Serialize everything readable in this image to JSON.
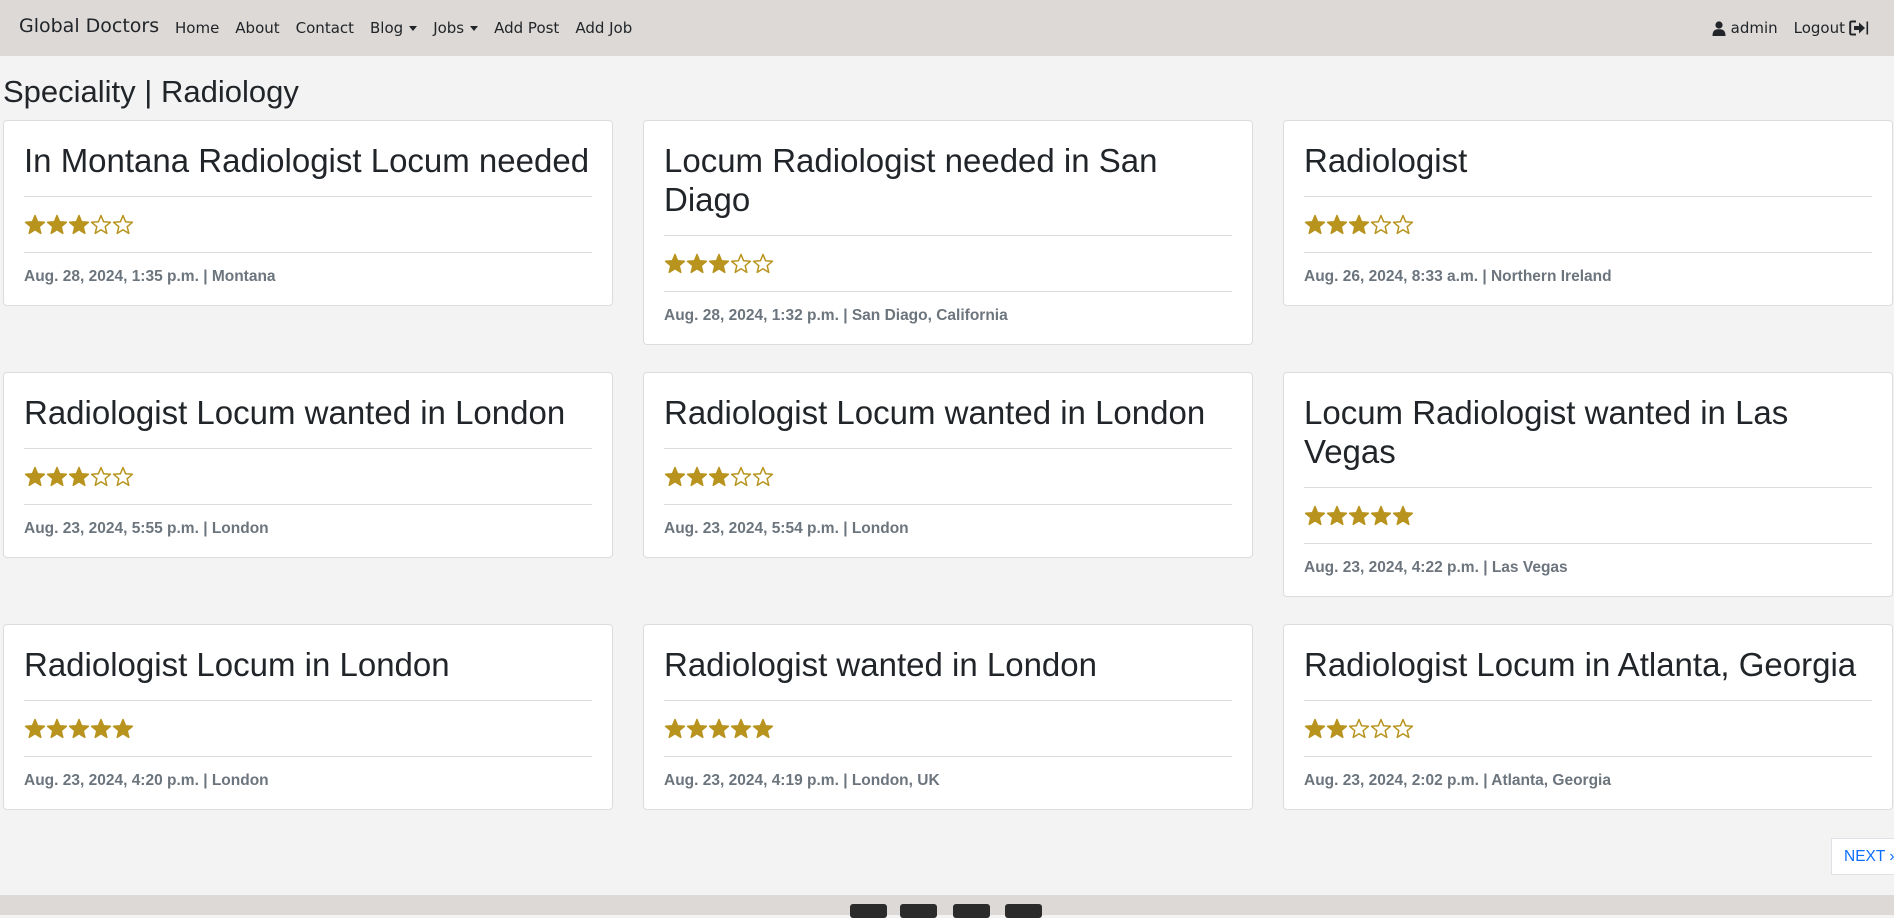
{
  "nav": {
    "brand": "Global Doctors",
    "links": [
      "Home",
      "About",
      "Contact",
      "Blog",
      "Jobs",
      "Add Post",
      "Add Job"
    ],
    "user": "admin",
    "logout": "Logout"
  },
  "page": {
    "title": "Speciality | Radiology"
  },
  "cards": [
    {
      "title": "In Montana Radiologist Locum needed",
      "rating": 3,
      "meta": "Aug. 28, 2024, 1:35 p.m. | Montana"
    },
    {
      "title": "Locum Radiologist needed in San Diago",
      "rating": 3,
      "meta": "Aug. 28, 2024, 1:32 p.m. | San Diago, California"
    },
    {
      "title": "Radiologist",
      "rating": 3,
      "meta": "Aug. 26, 2024, 8:33 a.m. | Northern Ireland"
    },
    {
      "title": "Radiologist Locum wanted in London",
      "rating": 3,
      "meta": "Aug. 23, 2024, 5:55 p.m. | London"
    },
    {
      "title": "Radiologist Locum wanted in London",
      "rating": 3,
      "meta": "Aug. 23, 2024, 5:54 p.m. | London"
    },
    {
      "title": "Locum Radiologist wanted in Las Vegas",
      "rating": 5,
      "meta": "Aug. 23, 2024, 4:22 p.m. | Las Vegas"
    },
    {
      "title": "Radiologist Locum in London",
      "rating": 5,
      "meta": "Aug. 23, 2024, 4:20 p.m. | London"
    },
    {
      "title": "Radiologist wanted in London",
      "rating": 5,
      "meta": "Aug. 23, 2024, 4:19 p.m. | London, UK"
    },
    {
      "title": "Radiologist Locum in Atlanta, Georgia",
      "rating": 2,
      "meta": "Aug. 23, 2024, 2:02 p.m. | Atlanta, Georgia"
    }
  ],
  "pagination": {
    "next": "NEXT »"
  },
  "colors": {
    "star": "#b8941f",
    "navbar": "#dcd9d6",
    "link": "#0d6efd"
  },
  "icons": {
    "user": "user-icon",
    "logout": "sign-out-icon",
    "star": "star-icon"
  }
}
